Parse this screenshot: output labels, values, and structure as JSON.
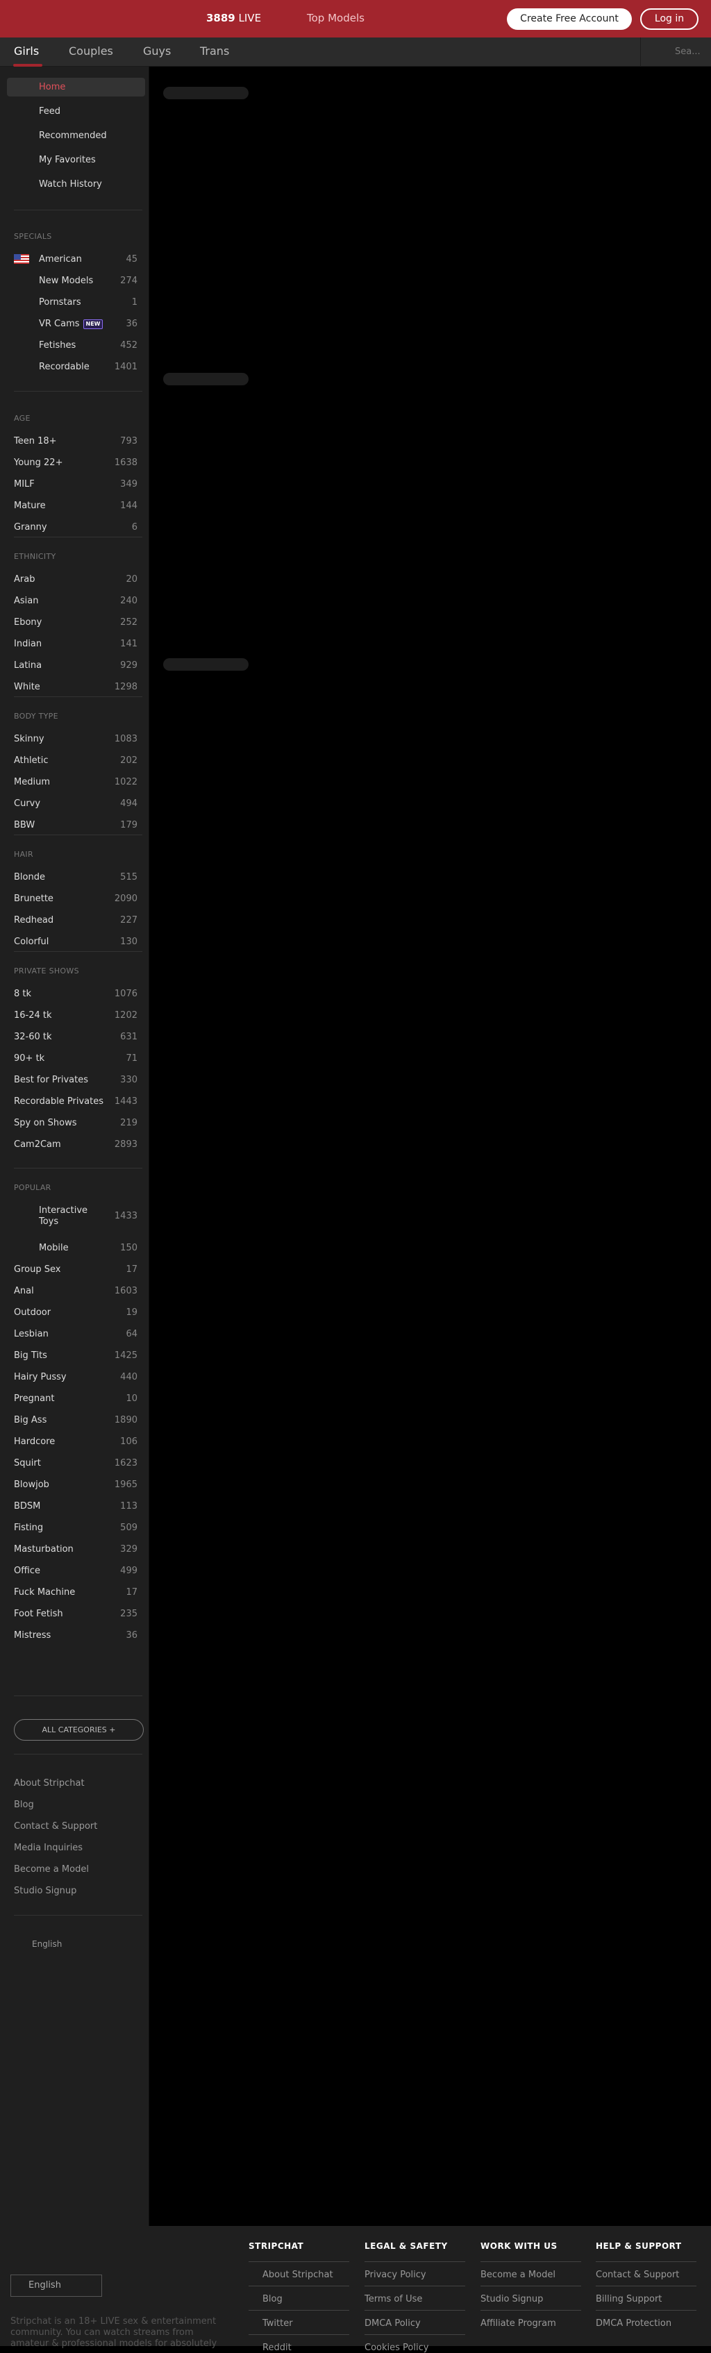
{
  "header": {
    "live_count": "3889",
    "live_label": "LIVE",
    "top_models": "Top Models",
    "create_account": "Create Free Account",
    "login": "Log in"
  },
  "nav": {
    "tabs": [
      "Girls",
      "Couples",
      "Guys",
      "Trans"
    ],
    "active": "Girls",
    "search_placeholder": "Sea..."
  },
  "sidebar": {
    "main": [
      "Home",
      "Feed",
      "Recommended",
      "My Favorites",
      "Watch History"
    ],
    "specials_title": "SPECIALS",
    "specials": [
      {
        "label": "American",
        "count": "45"
      },
      {
        "label": "New Models",
        "count": "274"
      },
      {
        "label": "Pornstars",
        "count": "1"
      },
      {
        "label": "VR Cams",
        "count": "36",
        "badge": "NEW"
      },
      {
        "label": "Fetishes",
        "count": "452"
      },
      {
        "label": "Recordable",
        "count": "1401"
      }
    ],
    "age_title": "AGE",
    "age": [
      {
        "label": "Teen 18+",
        "count": "793"
      },
      {
        "label": "Young 22+",
        "count": "1638"
      },
      {
        "label": "MILF",
        "count": "349"
      },
      {
        "label": "Mature",
        "count": "144"
      },
      {
        "label": "Granny",
        "count": "6"
      }
    ],
    "ethnicity_title": "ETHNICITY",
    "ethnicity": [
      {
        "label": "Arab",
        "count": "20"
      },
      {
        "label": "Asian",
        "count": "240"
      },
      {
        "label": "Ebony",
        "count": "252"
      },
      {
        "label": "Indian",
        "count": "141"
      },
      {
        "label": "Latina",
        "count": "929"
      },
      {
        "label": "White",
        "count": "1298"
      }
    ],
    "body_title": "BODY TYPE",
    "body": [
      {
        "label": "Skinny",
        "count": "1083"
      },
      {
        "label": "Athletic",
        "count": "202"
      },
      {
        "label": "Medium",
        "count": "1022"
      },
      {
        "label": "Curvy",
        "count": "494"
      },
      {
        "label": "BBW",
        "count": "179"
      }
    ],
    "hair_title": "HAIR",
    "hair": [
      {
        "label": "Blonde",
        "count": "515"
      },
      {
        "label": "Brunette",
        "count": "2090"
      },
      {
        "label": "Redhead",
        "count": "227"
      },
      {
        "label": "Colorful",
        "count": "130"
      }
    ],
    "private_title": "PRIVATE SHOWS",
    "private": [
      {
        "label": "8 tk",
        "count": "1076"
      },
      {
        "label": "16-24 tk",
        "count": "1202"
      },
      {
        "label": "32-60 tk",
        "count": "631"
      },
      {
        "label": "90+ tk",
        "count": "71"
      },
      {
        "label": "Best for Privates",
        "count": "330"
      },
      {
        "label": "Recordable Privates",
        "count": "1443"
      },
      {
        "label": "Spy on Shows",
        "count": "219"
      },
      {
        "label": "Cam2Cam",
        "count": "2893"
      }
    ],
    "popular_title": "POPULAR",
    "interactive_line1": "Interactive",
    "interactive_line2": "Toys",
    "interactive_count": "1433",
    "popular": [
      {
        "label": "Mobile",
        "count": "150",
        "indent": true
      },
      {
        "label": "Group Sex",
        "count": "17"
      },
      {
        "label": "Anal",
        "count": "1603"
      },
      {
        "label": "Outdoor",
        "count": "19"
      },
      {
        "label": "Lesbian",
        "count": "64"
      },
      {
        "label": "Big Tits",
        "count": "1425"
      },
      {
        "label": "Hairy Pussy",
        "count": "440"
      },
      {
        "label": "Pregnant",
        "count": "10"
      },
      {
        "label": "Big Ass",
        "count": "1890"
      },
      {
        "label": "Hardcore",
        "count": "106"
      },
      {
        "label": "Squirt",
        "count": "1623"
      },
      {
        "label": "Blowjob",
        "count": "1965"
      },
      {
        "label": "BDSM",
        "count": "113"
      },
      {
        "label": "Fisting",
        "count": "509"
      },
      {
        "label": "Masturbation",
        "count": "329"
      },
      {
        "label": "Office",
        "count": "499"
      },
      {
        "label": "Fuck Machine",
        "count": "17"
      },
      {
        "label": "Foot Fetish",
        "count": "235"
      },
      {
        "label": "Mistress",
        "count": "36"
      }
    ],
    "all_categories": "ALL CATEGORIES +",
    "footer_links": [
      "About Stripchat",
      "Blog",
      "Contact & Support",
      "Media Inquiries",
      "Become a Model",
      "Studio Signup"
    ],
    "language": "English"
  },
  "footer": {
    "language": "English",
    "blurb": "Stripchat is an 18+ LIVE sex & entertainment community. You can watch streams from amateur & professional models for absolutely",
    "columns": [
      {
        "title": "STRIPCHAT",
        "links": [
          "About Stripchat",
          "Blog",
          "Twitter",
          "Reddit"
        ]
      },
      {
        "title": "LEGAL & SAFETY",
        "links": [
          "Privacy Policy",
          "Terms of Use",
          "DMCA Policy",
          "Cookies Policy"
        ]
      },
      {
        "title": "WORK WITH US",
        "links": [
          "Become a Model",
          "Studio Signup",
          "Affiliate Program"
        ]
      },
      {
        "title": "HELP & SUPPORT",
        "links": [
          "Contact & Support",
          "Billing Support",
          "DMCA Protection"
        ]
      }
    ]
  },
  "colors": {
    "brand": "#a2252d",
    "accent_home": "#e0505a",
    "badge": "#8a6cf0"
  }
}
